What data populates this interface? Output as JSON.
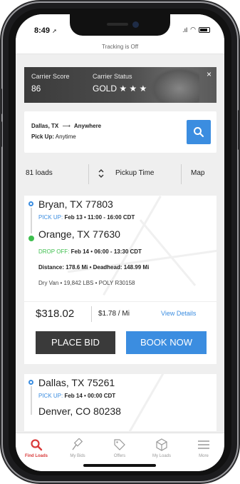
{
  "status_bar": {
    "time": "8:49",
    "signal": ".ıl"
  },
  "tracking_text": "Tracking is Off",
  "carrier": {
    "score_label": "Carrier Score",
    "score_value": "86",
    "status_label": "Carrier Status",
    "status_value": "GOLD ★ ★ ★",
    "close": "×"
  },
  "search": {
    "origin": "Dallas,  TX",
    "arrow": "⟶",
    "destination": "Anywhere",
    "pickup_label": "Pick Up:",
    "pickup_value": "Anytime"
  },
  "filters": {
    "count": "81 loads",
    "sort_label": "Pickup Time",
    "map_label": "Map"
  },
  "loads": [
    {
      "origin_city": "Bryan, TX 77803",
      "pickup_label": "PICK UP:",
      "pickup_time": "Feb 13 • 11:00 - 16:00 CDT",
      "dest_city": "Orange, TX 77630",
      "dropoff_label": "DROP OFF:",
      "dropoff_time": "Feb 14 • 06:00 - 13:30 CDT",
      "distance": "Distance: 178.6 Mi • Deadhead: 148.99 Mi",
      "equipment": "Dry Van  • 19,842 LBS • POLY R30158",
      "price": "$318.02",
      "per_mile": "$1.78 / Mi",
      "view_details": "View Details",
      "bid_label": "PLACE BID",
      "book_label": "BOOK NOW"
    },
    {
      "origin_city": "Dallas, TX 75261",
      "pickup_label": "PICK UP:",
      "pickup_time": "Feb 14 • 00:00 CDT",
      "dest_city": "Denver, CO 80238"
    }
  ],
  "tabs": [
    {
      "label": "Find Loads",
      "icon": "search-icon",
      "active": true
    },
    {
      "label": "My Bids",
      "icon": "gavel-icon",
      "active": false
    },
    {
      "label": "Offers",
      "icon": "tag-icon",
      "active": false
    },
    {
      "label": "My Loads",
      "icon": "box-icon",
      "active": false
    },
    {
      "label": "More",
      "icon": "menu-icon",
      "active": false
    }
  ],
  "colors": {
    "accent": "#3b8de0",
    "success": "#3fbf4f",
    "active_tab": "#d93a3a",
    "dark_button": "#3a3a3a"
  }
}
